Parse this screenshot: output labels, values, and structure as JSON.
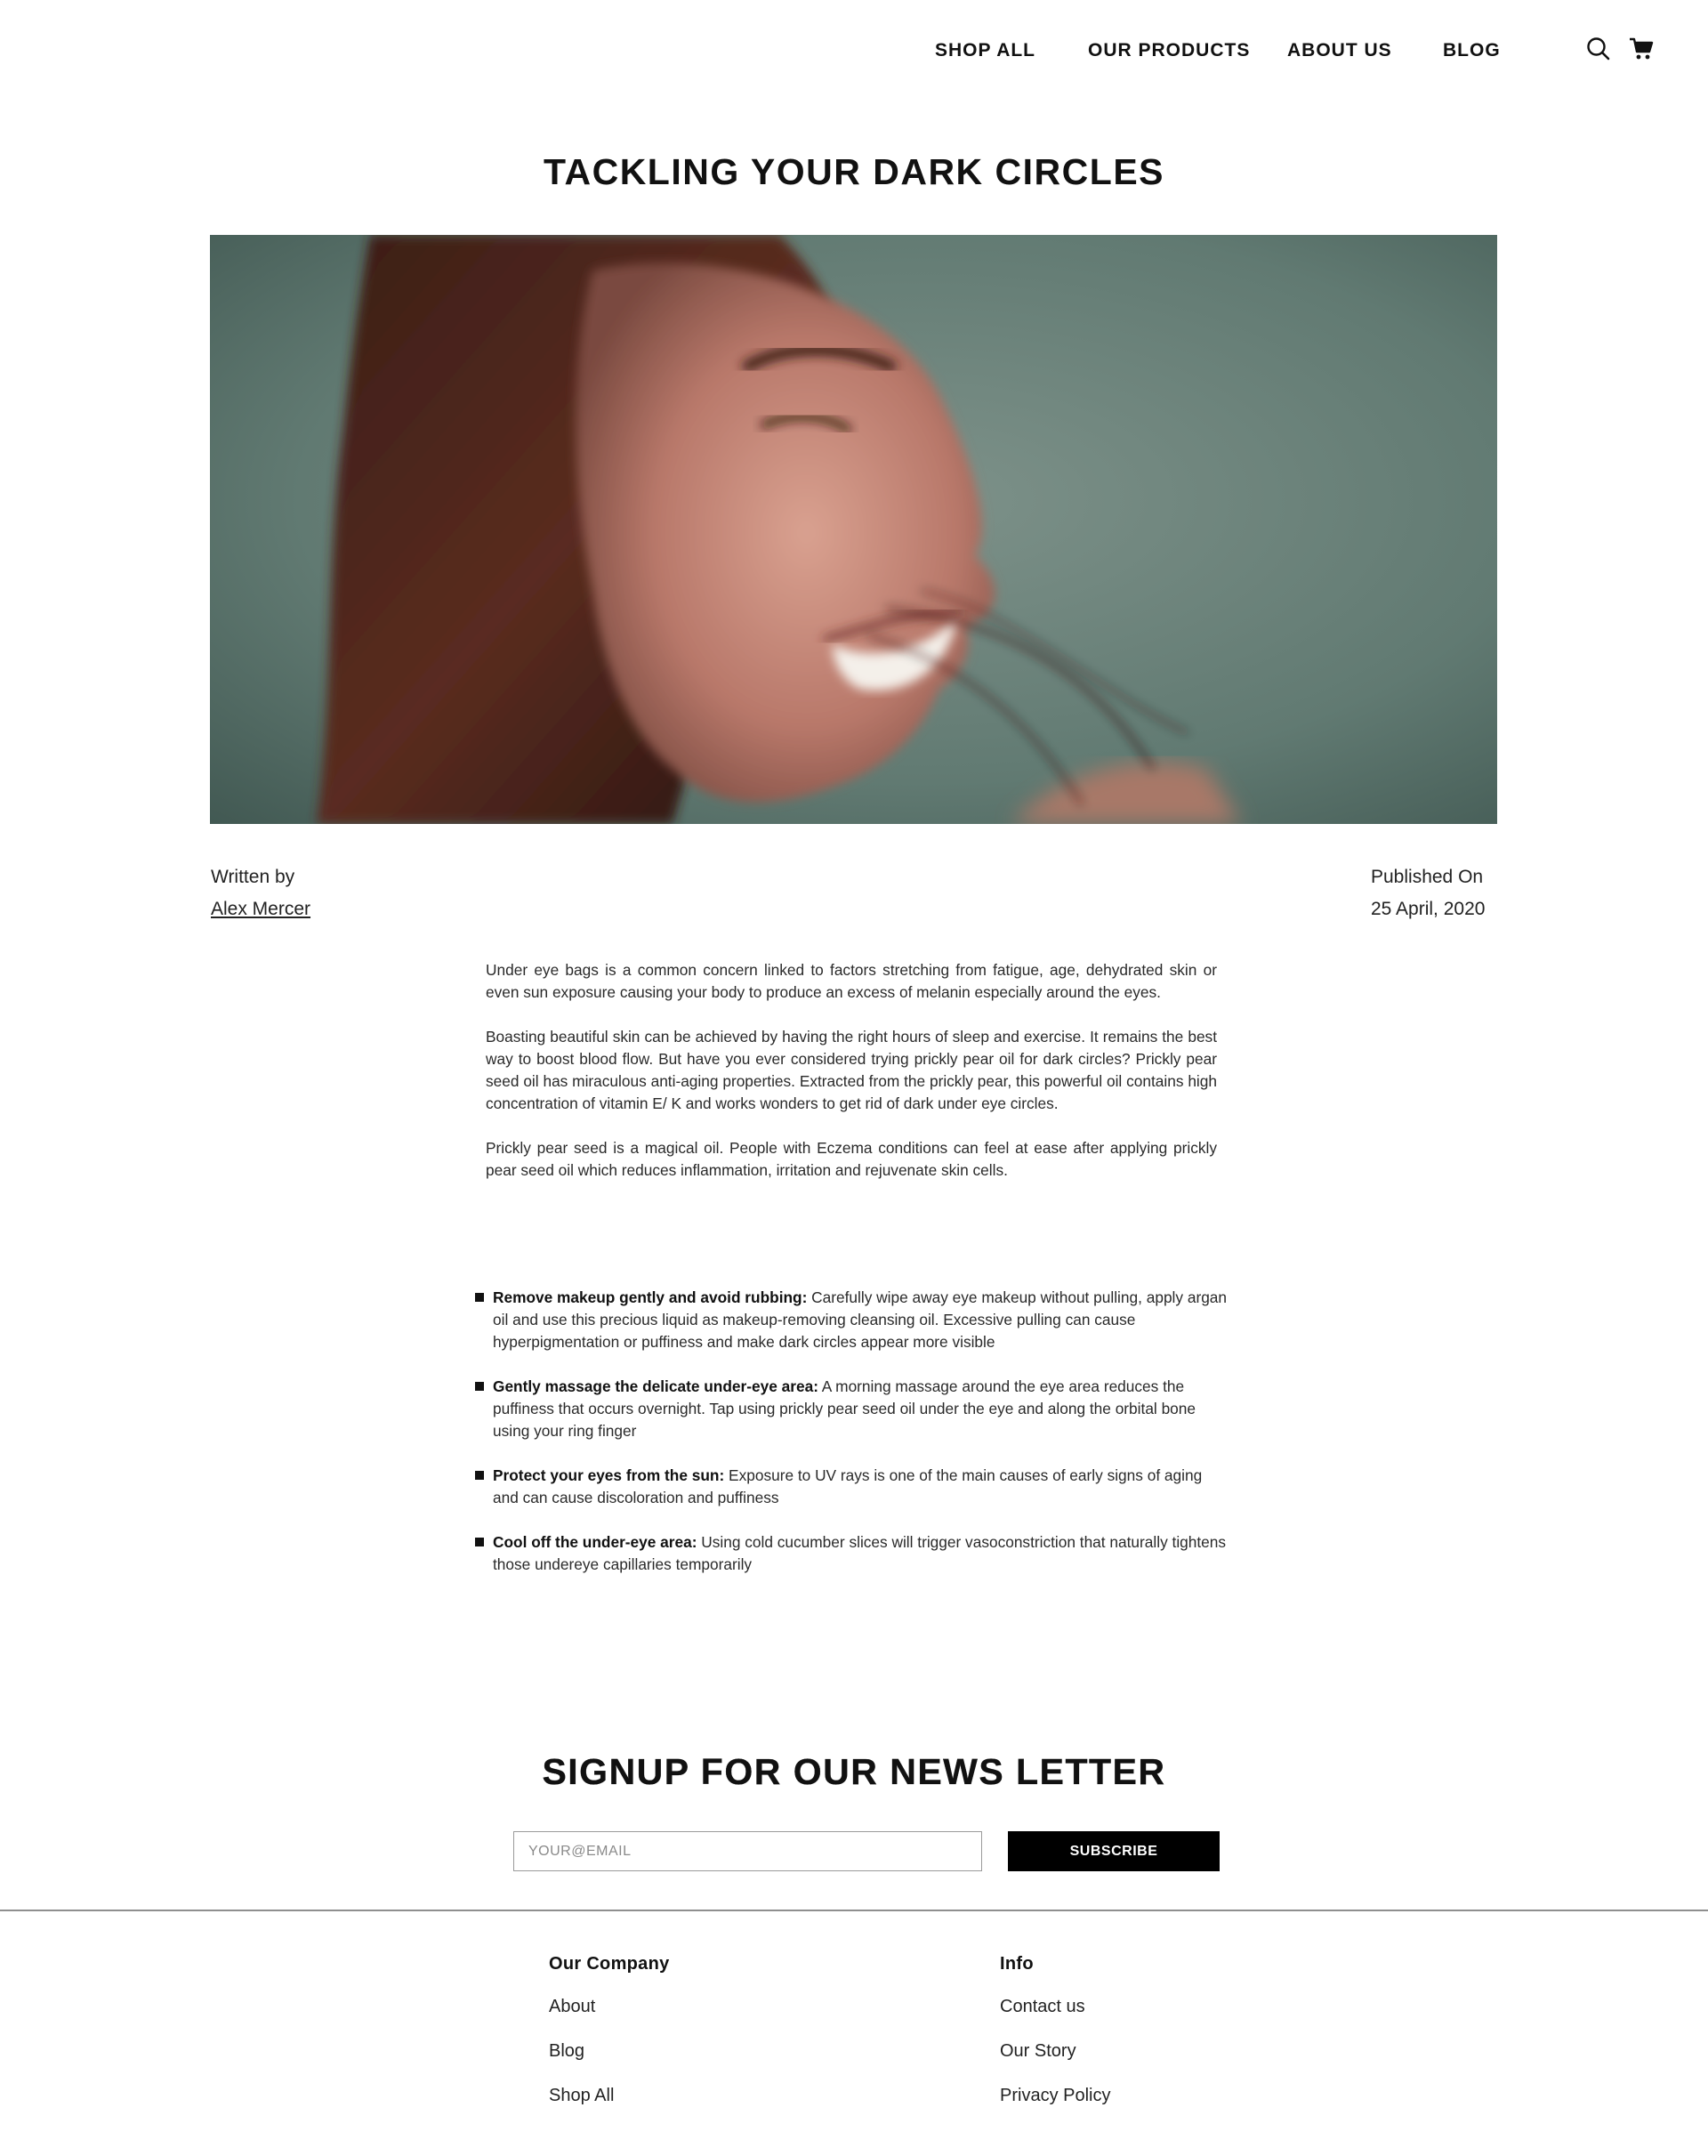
{
  "nav": {
    "items": [
      {
        "label": "SHOP ALL"
      },
      {
        "label": "OUR PRODUCTS"
      },
      {
        "label": "ABOUT US"
      },
      {
        "label": "BLOG"
      }
    ],
    "icons": [
      "search-icon",
      "cart-icon"
    ]
  },
  "article": {
    "title": "TACKLING YOUR DARK CIRCLES",
    "written_by_label": "Written by",
    "author": "Alex Mercer",
    "published_label": "Published On",
    "published_date": "25 April, 2020",
    "paragraphs": [
      "Under  eye bags is a common concern linked to factors stretching from fatigue, age, dehydrated skin or even sun exposure causing your body to produce an excess of melanin especially around the eyes.",
      "Boasting beautiful skin can be achieved by having the right hours of sleep and exercise. It remains the best way to boost blood flow. But have you ever considered trying prickly pear oil for dark circles? Prickly pear seed oil has miraculous anti-aging properties. Extracted from the prickly pear, this powerful oil contains high concentration of vitamin E/ K and works wonders to get rid of dark under eye circles.",
      "Prickly pear seed is a magical oil. People with Eczema conditions can feel at ease after applying prickly pear seed oil which reduces inflammation, irritation and rejuvenate skin cells."
    ],
    "tips": [
      {
        "heading": "Remove makeup gently and avoid rubbing:",
        "text": " Carefully wipe away eye makeup without pulling,   apply argan oil and use this precious liquid as makeup-removing cleansing oil. Excessive pulling can cause hyperpigmentation or puffiness and make dark circles appear more visible"
      },
      {
        "heading": "Gently massage the delicate under-eye area:",
        "text": " A morning massage around the eye area reduces the puffiness that occurs overnight. Tap using prickly pear seed oil under the eye and along the orbital bone using your ring finger"
      },
      {
        "heading": "Protect your eyes from the sun:",
        "text": " Exposure to UV rays is one of the main causes of early signs of aging and can cause discoloration and puffiness"
      },
      {
        "heading": "Cool off the under-eye area:",
        "text": " Using cold cucumber slices will trigger vasoconstriction that naturally tightens those undereye capillaries temporarily"
      }
    ]
  },
  "newsletter": {
    "title": "SIGNUP FOR OUR NEWS LETTER",
    "email_placeholder": "YOUR@EMAIL",
    "subscribe_label": "SUBSCRIBE"
  },
  "footer": {
    "company": {
      "heading": "Our Company",
      "links": [
        "About",
        "Blog",
        "Shop All"
      ]
    },
    "info": {
      "heading": "Info",
      "links": [
        "Contact us",
        "Our Story",
        "Privacy Policy"
      ]
    }
  },
  "colors": {
    "text": "#111111",
    "button_bg": "#000000",
    "button_text": "#ffffff",
    "divider": "#8f8f8f",
    "hero_background": "#5c726a"
  }
}
